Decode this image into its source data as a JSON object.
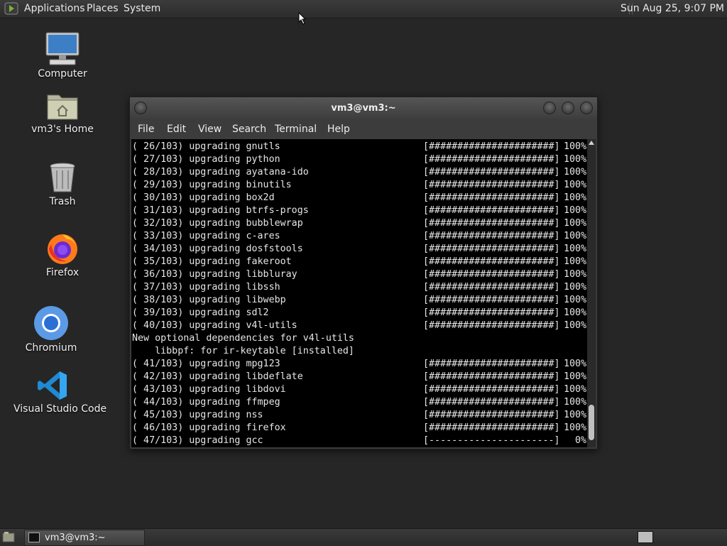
{
  "top_panel": {
    "menus": [
      "Applications",
      "Places",
      "System"
    ],
    "clock": "Sun Aug 25,  9:07 PM"
  },
  "desktop_icons": [
    {
      "label": "Computer",
      "icon": "computer-icon"
    },
    {
      "label": "vm3's Home",
      "icon": "home-folder-icon"
    },
    {
      "label": "Trash",
      "icon": "trash-icon"
    },
    {
      "label": "Firefox",
      "icon": "firefox-icon"
    },
    {
      "label": "Chromium",
      "icon": "chromium-icon"
    },
    {
      "label": "Visual Studio Code",
      "icon": "vscode-icon"
    }
  ],
  "terminal": {
    "title": "vm3@vm3:~",
    "menu": [
      "File",
      "Edit",
      "View",
      "Search",
      "Terminal",
      "Help"
    ],
    "lines": [
      {
        "text": "( 26/103) upgrading gnutls",
        "bar": "[######################]",
        "pct": "100%"
      },
      {
        "text": "( 27/103) upgrading python",
        "bar": "[######################]",
        "pct": "100%"
      },
      {
        "text": "( 28/103) upgrading ayatana-ido",
        "bar": "[######################]",
        "pct": "100%"
      },
      {
        "text": "( 29/103) upgrading binutils",
        "bar": "[######################]",
        "pct": "100%"
      },
      {
        "text": "( 30/103) upgrading box2d",
        "bar": "[######################]",
        "pct": "100%"
      },
      {
        "text": "( 31/103) upgrading btrfs-progs",
        "bar": "[######################]",
        "pct": "100%"
      },
      {
        "text": "( 32/103) upgrading bubblewrap",
        "bar": "[######################]",
        "pct": "100%"
      },
      {
        "text": "( 33/103) upgrading c-ares",
        "bar": "[######################]",
        "pct": "100%"
      },
      {
        "text": "( 34/103) upgrading dosfstools",
        "bar": "[######################]",
        "pct": "100%"
      },
      {
        "text": "( 35/103) upgrading fakeroot",
        "bar": "[######################]",
        "pct": "100%"
      },
      {
        "text": "( 36/103) upgrading libbluray",
        "bar": "[######################]",
        "pct": "100%"
      },
      {
        "text": "( 37/103) upgrading libssh",
        "bar": "[######################]",
        "pct": "100%"
      },
      {
        "text": "( 38/103) upgrading libwebp",
        "bar": "[######################]",
        "pct": "100%"
      },
      {
        "text": "( 39/103) upgrading sdl2",
        "bar": "[######################]",
        "pct": "100%"
      },
      {
        "text": "( 40/103) upgrading v4l-utils",
        "bar": "[######################]",
        "pct": "100%"
      },
      {
        "text": "New optional dependencies for v4l-utils",
        "bar": "",
        "pct": ""
      },
      {
        "text": "    libbpf: for ir-keytable [installed]",
        "bar": "",
        "pct": ""
      },
      {
        "text": "( 41/103) upgrading mpg123",
        "bar": "[######################]",
        "pct": "100%"
      },
      {
        "text": "( 42/103) upgrading libdeflate",
        "bar": "[######################]",
        "pct": "100%"
      },
      {
        "text": "( 43/103) upgrading libdovi",
        "bar": "[######################]",
        "pct": "100%"
      },
      {
        "text": "( 44/103) upgrading ffmpeg",
        "bar": "[######################]",
        "pct": "100%"
      },
      {
        "text": "( 45/103) upgrading nss",
        "bar": "[######################]",
        "pct": "100%"
      },
      {
        "text": "( 46/103) upgrading firefox",
        "bar": "[######################]",
        "pct": "100%"
      },
      {
        "text": "( 47/103) upgrading gcc",
        "bar": "[----------------------]",
        "pct": "0%"
      }
    ]
  },
  "taskbar": {
    "window_button": "vm3@vm3:~"
  }
}
